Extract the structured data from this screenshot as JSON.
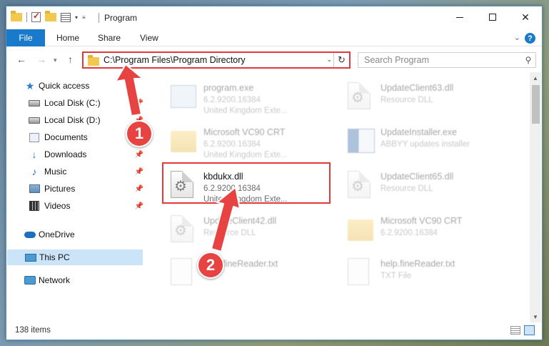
{
  "window": {
    "title": "Program"
  },
  "ribbon": {
    "file": "File",
    "home": "Home",
    "share": "Share",
    "view": "View",
    "help": "?"
  },
  "address": {
    "path": "C:\\Program Files\\Program Directory",
    "search_placeholder": "Search Program"
  },
  "sidebar": {
    "items": [
      {
        "label": "Quick access",
        "icon": "star-icon"
      },
      {
        "label": "Local Disk (C:)",
        "icon": "drive-icon",
        "pinned": true
      },
      {
        "label": "Local Disk (D:)",
        "icon": "drive-icon",
        "pinned": true
      },
      {
        "label": "Documents",
        "icon": "documents-icon",
        "pinned": true
      },
      {
        "label": "Downloads",
        "icon": "downloads-icon",
        "pinned": true
      },
      {
        "label": "Music",
        "icon": "music-icon",
        "pinned": true
      },
      {
        "label": "Pictures",
        "icon": "pictures-icon",
        "pinned": true
      },
      {
        "label": "Videos",
        "icon": "videos-icon",
        "pinned": true
      },
      {
        "label": "OneDrive",
        "icon": "onedrive-icon"
      },
      {
        "label": "This PC",
        "icon": "pc-icon",
        "selected": true
      },
      {
        "label": "Network",
        "icon": "network-icon"
      }
    ]
  },
  "files": [
    {
      "name": "program.exe",
      "d1": "6.2.9200.16384",
      "d2": "United Kingdom Exte...",
      "icon": "exe-icon"
    },
    {
      "name": "UpdateClient63.dll",
      "d1": "Resource DLL",
      "d2": "",
      "icon": "dll-icon"
    },
    {
      "name": "Microsoft VC90 CRT",
      "d1": "6.2.9200.16384",
      "d2": "United Kingdom Exte...",
      "icon": "folder-icon"
    },
    {
      "name": "UpdateInstaller.exe",
      "d1": "ABBYY updates installer",
      "d2": "",
      "icon": "installer-icon"
    },
    {
      "name": "kbdukx.dll",
      "d1": "6.2.9200.16384",
      "d2": "United Kingdom Exte...",
      "icon": "dll-icon"
    },
    {
      "name": "UpdateClient65.dll",
      "d1": "Resource DLL",
      "d2": "",
      "icon": "dll-icon"
    },
    {
      "name": "UpdateClient42.dll",
      "d1": "Resource DLL",
      "d2": "",
      "icon": "dll-icon"
    },
    {
      "name": "Microsoft VC90 CRT",
      "d1": "6.2.9200.16384",
      "d2": "",
      "icon": "folder-icon"
    },
    {
      "name": "help.fineReader.txt",
      "d1": "",
      "d2": "",
      "icon": "text-file-icon"
    },
    {
      "name": "help.fineReader.txt",
      "d1": "TXT File",
      "d2": "",
      "icon": "text-file-icon"
    }
  ],
  "callouts": {
    "one": "1",
    "two": "2"
  },
  "status": {
    "count": "138 items"
  },
  "colors": {
    "accent": "#1979ca",
    "highlight": "#e23a3a",
    "selected": "#cce4f7"
  }
}
